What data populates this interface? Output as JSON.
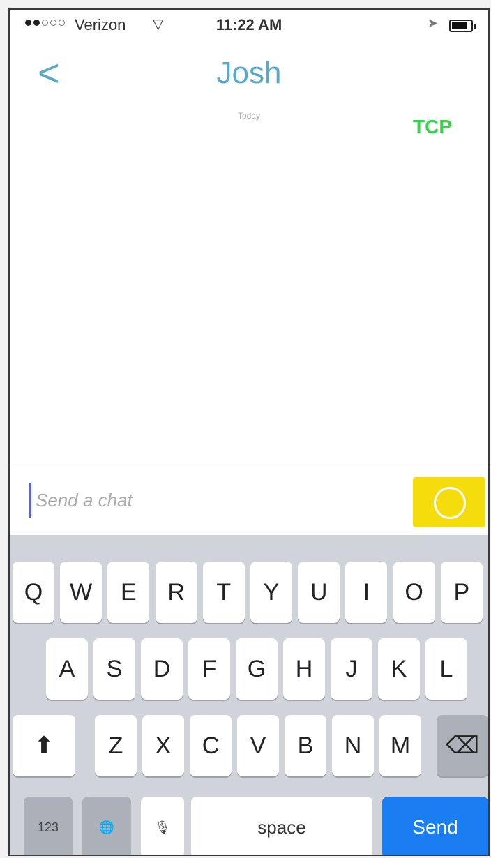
{
  "status_bar": {
    "carrier": "Verizon",
    "time": "11:22 AM",
    "signal_icon": "signal-dots-icon",
    "wifi_icon": "wifi-icon",
    "location_icon": "location-arrow-icon",
    "battery_icon": "battery-icon",
    "battery_level": 0.8
  },
  "header": {
    "back_glyph": "<",
    "title": "Josh",
    "subtitle": "Today",
    "tag": "TCP"
  },
  "composer": {
    "placeholder": "Send a chat",
    "capture_icon": "camera-capture-icon"
  },
  "keyboard": {
    "row1": [
      "Q",
      "W",
      "E",
      "R",
      "T",
      "Y",
      "U",
      "I",
      "O",
      "P"
    ],
    "row2": [
      "A",
      "S",
      "D",
      "F",
      "G",
      "H",
      "J",
      "K",
      "L"
    ],
    "row3": [
      "Z",
      "X",
      "C",
      "V",
      "B",
      "N",
      "M"
    ],
    "shift_glyph": "⬆",
    "delete_glyph": "⌫",
    "numbers_label": "123",
    "globe_glyph": "🌐",
    "mic_glyph": "🎙",
    "space_label": "space",
    "send_label": "Send"
  },
  "colors": {
    "accent": "#5aa8c6",
    "tag": "#3ccf50",
    "capture": "#f5dc0d",
    "send": "#1a7ef2"
  }
}
